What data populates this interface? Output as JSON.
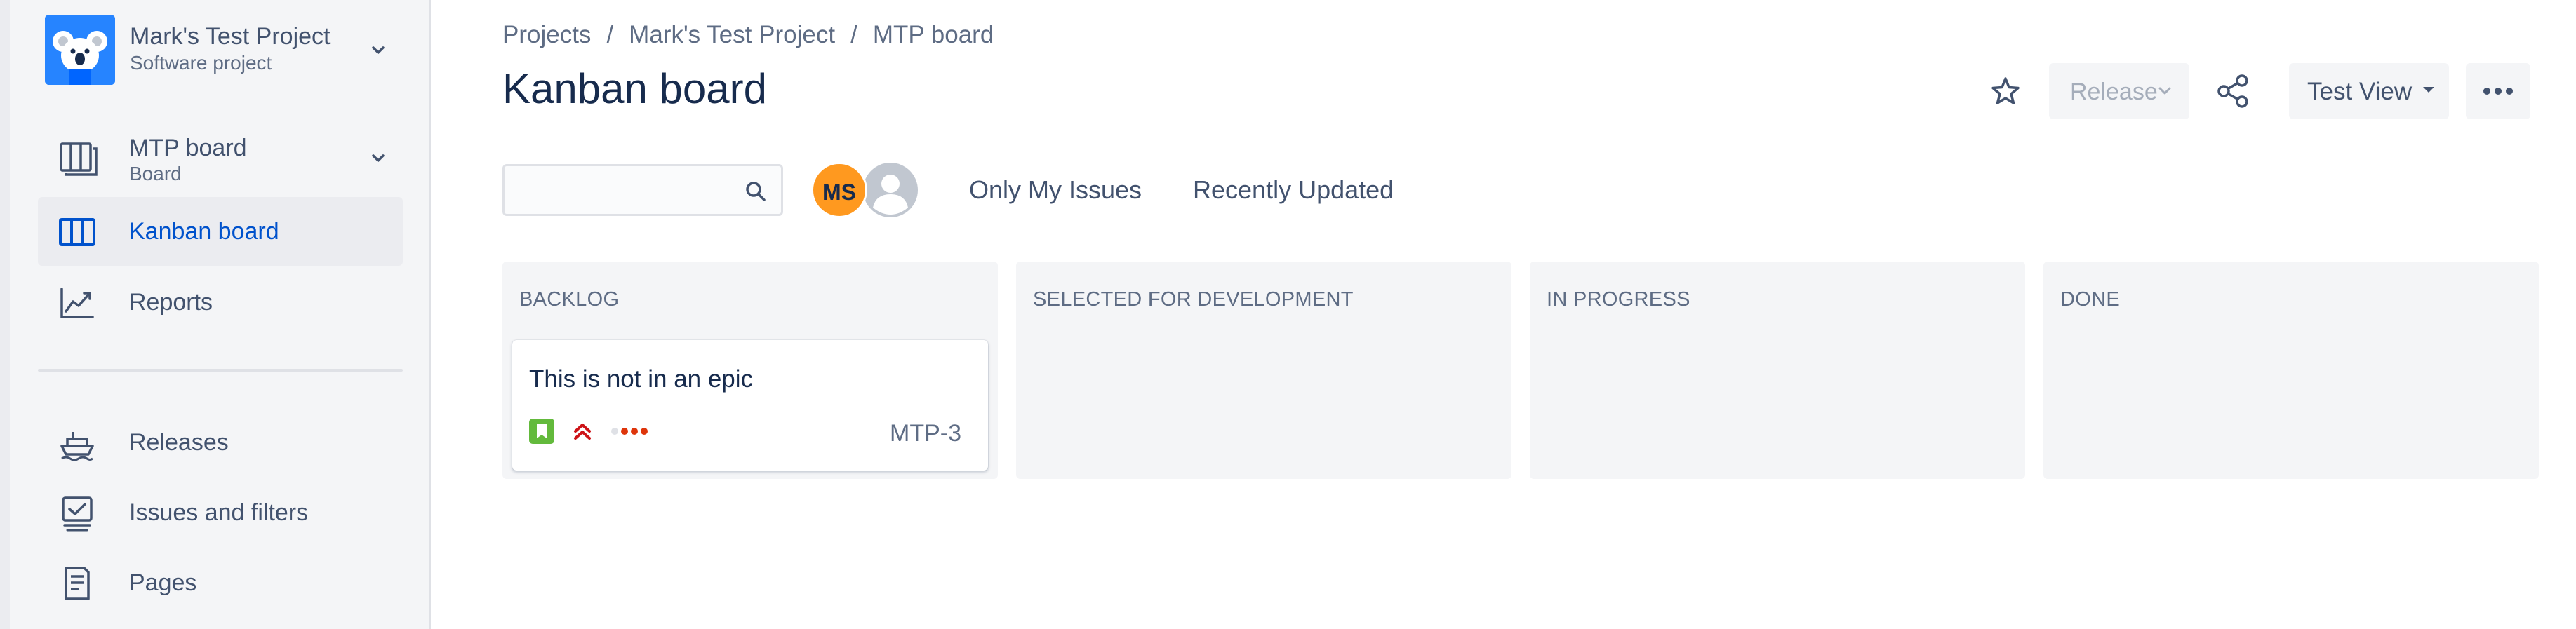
{
  "sidebar": {
    "project": {
      "name": "Mark's Test Project",
      "type": "Software project"
    },
    "board": {
      "name": "MTP board",
      "type": "Board"
    },
    "items": [
      {
        "label": "Kanban board",
        "icon": "kanban-icon",
        "active": true
      },
      {
        "label": "Reports",
        "icon": "chart-icon",
        "active": false
      },
      {
        "label": "Releases",
        "icon": "ship-icon",
        "active": false
      },
      {
        "label": "Issues and filters",
        "icon": "issues-icon",
        "active": false
      },
      {
        "label": "Pages",
        "icon": "page-icon",
        "active": false
      }
    ]
  },
  "breadcrumb": [
    "Projects",
    "Mark's Test Project",
    "MTP board"
  ],
  "page_title": "Kanban board",
  "toolbar": {
    "release_label": "Release",
    "view_label": "Test View",
    "star_icon": "star-icon",
    "share_icon": "share-icon",
    "more_icon": "more-icon"
  },
  "filters": {
    "search_value": "",
    "avatar_initials": "MS",
    "only_my_issues": "Only My Issues",
    "recently_updated": "Recently Updated"
  },
  "columns": [
    {
      "title": "BACKLOG",
      "cards": [
        {
          "summary": "This is not in an epic",
          "key": "MTP-3",
          "type_icon": "story-icon",
          "priority_icon": "highest-priority-icon"
        }
      ]
    },
    {
      "title": "SELECTED FOR DEVELOPMENT",
      "cards": []
    },
    {
      "title": "IN PROGRESS",
      "cards": []
    },
    {
      "title": "DONE",
      "cards": []
    }
  ],
  "colors": {
    "accent": "#0052cc",
    "avatar": "#ff991f",
    "story": "#63ba3c",
    "priority": "#cd1317"
  }
}
